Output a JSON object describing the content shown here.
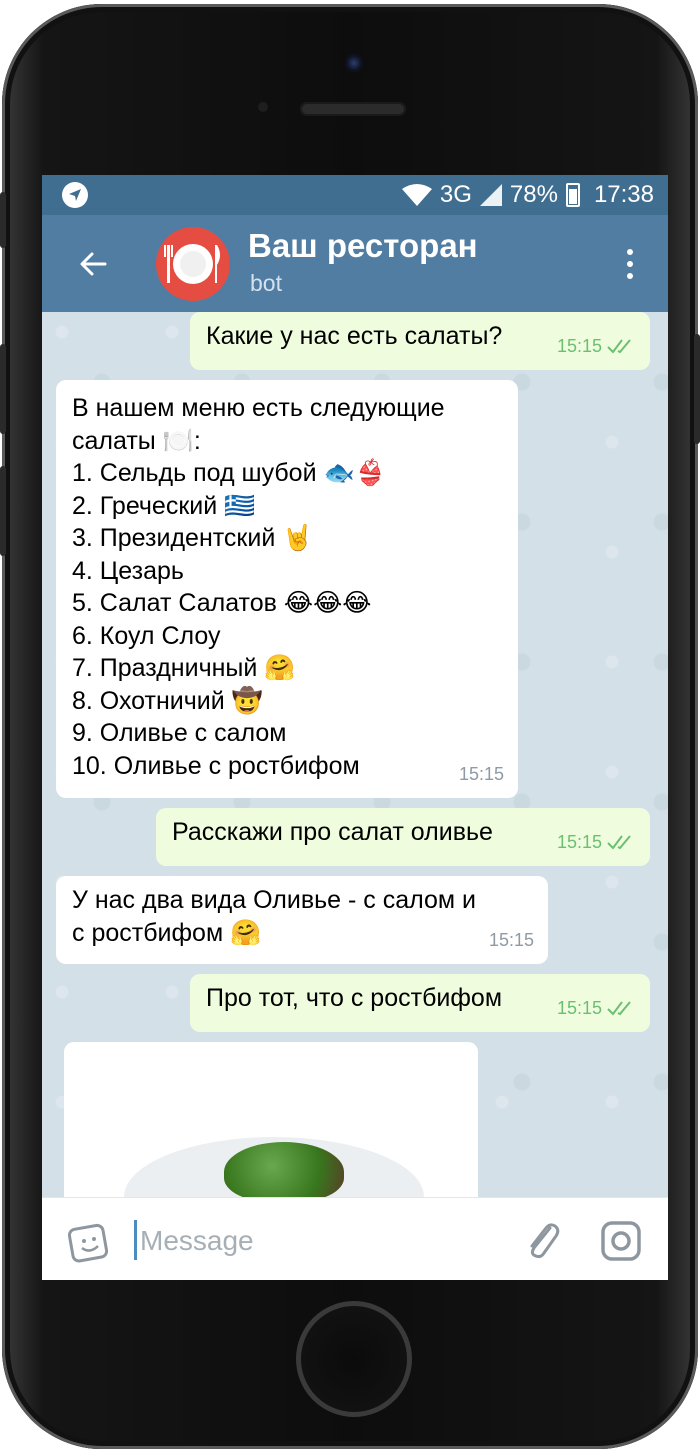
{
  "status_bar": {
    "network": "3G",
    "battery": "78%",
    "time": "17:38"
  },
  "header": {
    "title": "Ваш ресторан",
    "subtitle": "bot"
  },
  "messages": [
    {
      "direction": "outgoing",
      "lines": [
        "Какие у нас есть салаты?"
      ],
      "time": "15:15"
    },
    {
      "direction": "incoming",
      "lines": [
        "В нашем меню есть следующие",
        "салаты 🍽️:",
        "1. Сельдь под шубой 🐟👙",
        "2. Греческий 🇬🇷",
        "3. Президентский 🤘",
        "4. Цезарь",
        "5. Салат Салатов 😂😂😂",
        "6. Коул Слоу",
        "7. Праздничный 🤗",
        "8. Охотничий 🤠",
        "9. Оливье с салом",
        "10. Оливье с ростбифом"
      ],
      "time": "15:15"
    },
    {
      "direction": "outgoing",
      "lines": [
        "Расскажи про салат оливье"
      ],
      "time": "15:15"
    },
    {
      "direction": "incoming",
      "lines": [
        "У нас два вида Оливье - с салом и",
        "с ростбифом 🤗"
      ],
      "time": "15:15"
    },
    {
      "direction": "outgoing",
      "lines": [
        "Про тот, что с ростбифом"
      ],
      "time": "15:15"
    }
  ],
  "input": {
    "placeholder": "Message"
  },
  "icons": {
    "back": "back-arrow-icon",
    "menu": "more-vertical-icon",
    "sticker": "sticker-icon",
    "attach": "paperclip-icon",
    "camera": "camera-icon",
    "read_receipt": "double-check-icon"
  },
  "colors": {
    "status_bar": "#406e91",
    "app_bar": "#517da2",
    "outgoing_bubble": "#effdde",
    "incoming_bubble": "#ffffff",
    "chat_background": "#d4e0e8",
    "avatar": "#e54d42"
  }
}
